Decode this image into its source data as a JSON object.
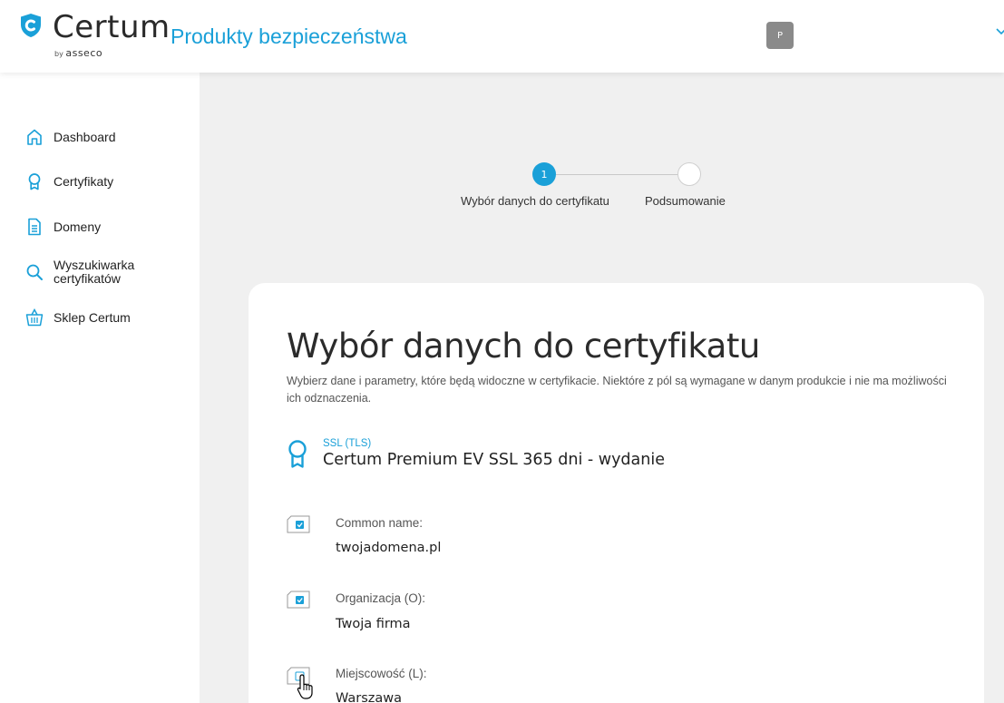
{
  "header": {
    "logo_word": "Certum",
    "logo_by": "by",
    "logo_brand": "asseco",
    "product_title": "Produkty bezpieczeństwa",
    "avatar_initial": "P"
  },
  "sidebar": {
    "items": [
      {
        "label": "Dashboard",
        "icon": "home-icon"
      },
      {
        "label": "Certyfikaty",
        "icon": "certificate-icon"
      },
      {
        "label": "Domeny",
        "icon": "document-icon"
      },
      {
        "label_line1": "Wyszukiwarka",
        "label_line2": "certyfikatów",
        "icon": "search-icon"
      },
      {
        "label": "Sklep Certum",
        "icon": "basket-icon"
      }
    ]
  },
  "stepper": {
    "steps": [
      {
        "number": "1",
        "label": "Wybór danych do certyfikatu",
        "active": true
      },
      {
        "number": "",
        "label": "Podsumowanie",
        "active": false
      }
    ]
  },
  "card": {
    "title": "Wybór danych do certyfikatu",
    "description": "Wybierz dane i parametry, które będą widoczne w certyfikacie. Niektóre z pól są wymagane w danym produkcie i nie ma możliwości ich odznaczenia.",
    "cert_type": "SSL (TLS)",
    "cert_name": "Certum Premium EV SSL 365 dni - wydanie",
    "fields": [
      {
        "label": "Common name:",
        "value": "twojadomena.pl",
        "checked": true
      },
      {
        "label": "Organizacja (O):",
        "value": "Twoja firma",
        "checked": true
      },
      {
        "label": "Miejscowość (L):",
        "value": "Warszawa",
        "checked": false
      }
    ]
  },
  "colors": {
    "accent": "#1aa0d8",
    "background": "#f0f0f0",
    "card": "#ffffff",
    "avatar": "#8a8a8a"
  }
}
